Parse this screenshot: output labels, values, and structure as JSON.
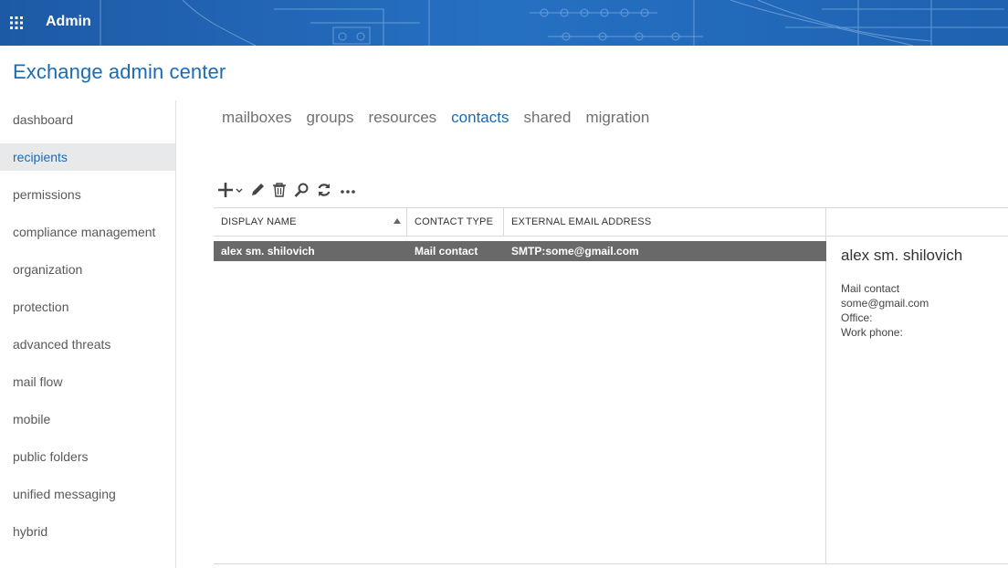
{
  "header": {
    "app_name": "Admin",
    "waffle_icon": "app-launcher-icon",
    "bar_color": "#1b63b3"
  },
  "page": {
    "title": "Exchange admin center"
  },
  "sidebar": {
    "items": [
      {
        "label": "dashboard",
        "active": false
      },
      {
        "label": "recipients",
        "active": true
      },
      {
        "label": "permissions",
        "active": false
      },
      {
        "label": "compliance management",
        "active": false
      },
      {
        "label": "organization",
        "active": false
      },
      {
        "label": "protection",
        "active": false
      },
      {
        "label": "advanced threats",
        "active": false
      },
      {
        "label": "mail flow",
        "active": false
      },
      {
        "label": "mobile",
        "active": false
      },
      {
        "label": "public folders",
        "active": false
      },
      {
        "label": "unified messaging",
        "active": false
      },
      {
        "label": "hybrid",
        "active": false
      }
    ]
  },
  "tabs": [
    {
      "label": "mailboxes",
      "active": false
    },
    {
      "label": "groups",
      "active": false
    },
    {
      "label": "resources",
      "active": false
    },
    {
      "label": "contacts",
      "active": true
    },
    {
      "label": "shared",
      "active": false
    },
    {
      "label": "migration",
      "active": false
    }
  ],
  "toolbar": {
    "buttons": [
      "add-icon",
      "edit-icon",
      "delete-icon",
      "search-icon",
      "refresh-icon",
      "more-icon"
    ]
  },
  "table": {
    "columns": [
      "DISPLAY NAME",
      "CONTACT TYPE",
      "EXTERNAL EMAIL ADDRESS"
    ],
    "sort_column": "DISPLAY NAME",
    "sort_direction": "ascending",
    "rows": [
      {
        "display_name": "alex sm. shilovich",
        "contact_type": "Mail contact",
        "email": "SMTP:some@gmail.com",
        "selected": true
      }
    ]
  },
  "details": {
    "name": "alex sm. shilovich",
    "type": "Mail contact",
    "email": "some@gmail.com",
    "office": "Office:",
    "work_phone": "Work phone:"
  },
  "colors": {
    "accent": "#1a6bb5",
    "selected_row": "#696969",
    "nav_active_bg": "#e8e9eb"
  }
}
